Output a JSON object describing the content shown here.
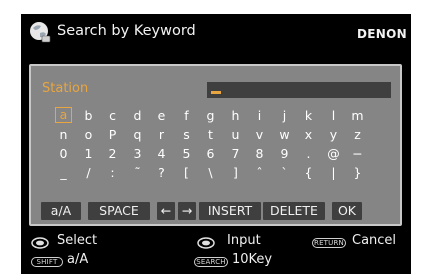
{
  "header": {
    "title": "Search by Keyword",
    "brand": "DENON"
  },
  "input": {
    "label": "Station",
    "value": ""
  },
  "keyboard": {
    "rows": [
      [
        "a",
        "b",
        "c",
        "d",
        "e",
        "f",
        "g",
        "h",
        "i",
        "j",
        "k",
        "l",
        "m"
      ],
      [
        "n",
        "o",
        "P",
        "q",
        "r",
        "s",
        "t",
        "u",
        "v",
        "w",
        "x",
        "y",
        "z"
      ],
      [
        "0",
        "1",
        "2",
        "3",
        "4",
        "5",
        "6",
        "7",
        "8",
        "9",
        ".",
        "@",
        "−"
      ],
      [
        "_",
        "/",
        ":",
        "˜",
        "?",
        "[",
        "\\",
        "]",
        "ˆ",
        "`",
        "{",
        "|",
        "}"
      ]
    ],
    "selected": "a",
    "functions": [
      "a/A",
      "SPACE",
      "←",
      "→",
      "INSERT",
      "DELETE",
      "OK"
    ]
  },
  "footer": {
    "select_label": "Select",
    "input_label": "Input",
    "return_key": "RETURN",
    "cancel_label": "Cancel",
    "shift_key": "SHIFT",
    "shift_label": "a/A",
    "search_key": "SEARCH",
    "search_label": "10Key"
  },
  "colors": {
    "accent": "#e8a540",
    "panel": "#858585",
    "button": "#3f3f3f",
    "background": "#000000"
  }
}
